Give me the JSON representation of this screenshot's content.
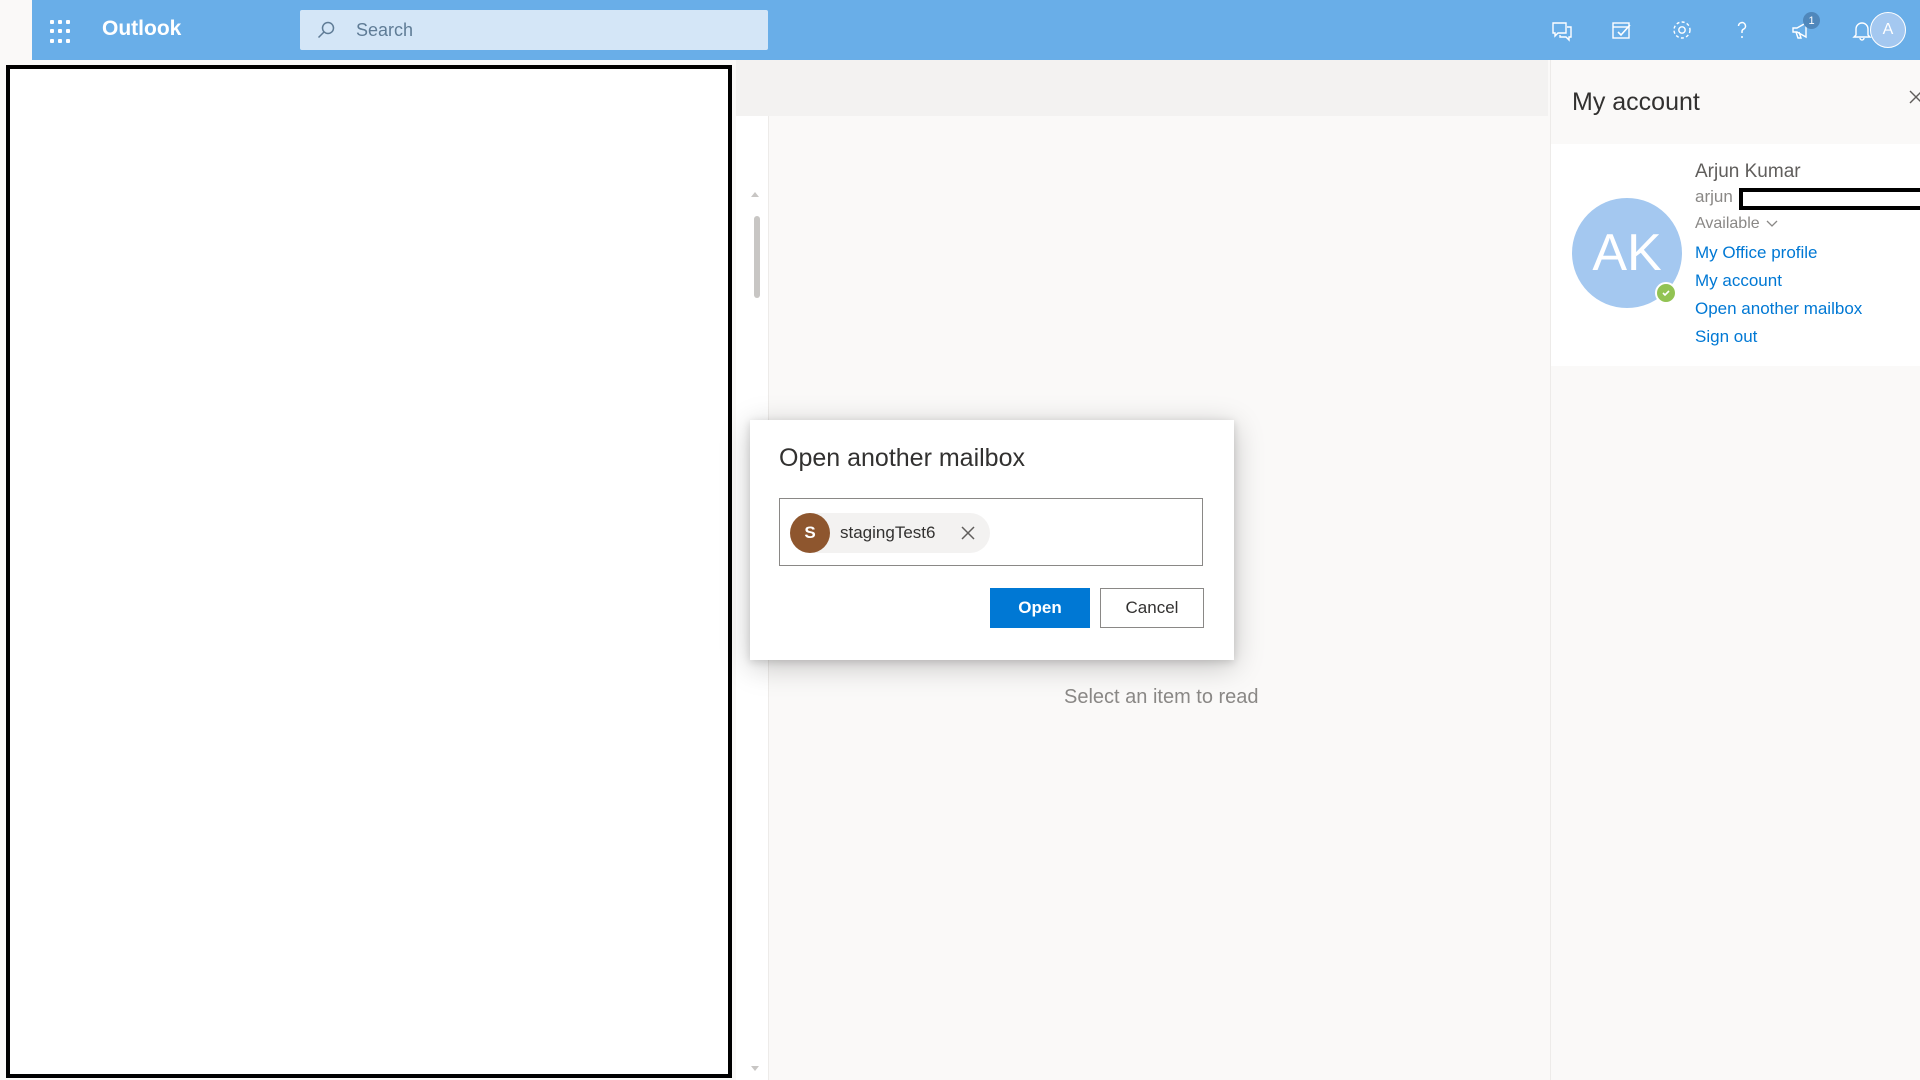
{
  "header": {
    "app_name": "Outlook",
    "search_placeholder": "Search",
    "notification_badge_count": "1",
    "user_initial": "A",
    "icons": [
      "waffle-icon",
      "chat-icon",
      "todo-icon",
      "settings-icon",
      "help-icon",
      "megaphone-icon",
      "bell-icon"
    ]
  },
  "reading_pane": {
    "hint": "Select an item to read"
  },
  "dialog": {
    "title": "Open another mailbox",
    "recipient": {
      "initial": "S",
      "name": "stagingTest6"
    },
    "open_label": "Open",
    "cancel_label": "Cancel"
  },
  "account_panel": {
    "title": "My account",
    "initials": "AK",
    "name": "Arjun Kumar",
    "email_partial": "arjun",
    "status": "Available",
    "links": {
      "office_profile": "My Office profile",
      "my_account": "My account",
      "open_mailbox": "Open another mailbox",
      "sign_out": "Sign out"
    }
  },
  "colors": {
    "header_bg": "#69aee8",
    "primary": "#0078d4",
    "persona": "#8e562e",
    "presence_available": "#92c353"
  }
}
